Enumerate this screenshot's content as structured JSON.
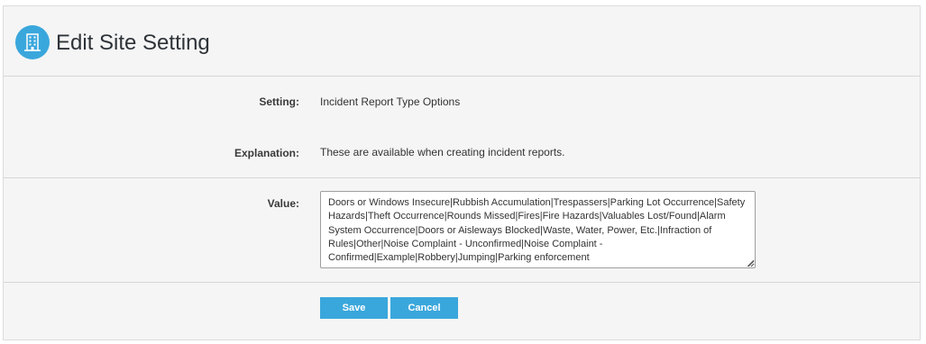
{
  "header": {
    "title": "Edit Site Setting",
    "icon": "building-icon",
    "icon_color": "#3aa7dc"
  },
  "form": {
    "setting_label": "Setting:",
    "setting_value": "Incident Report Type Options",
    "explanation_label": "Explanation:",
    "explanation_value": "These are available when creating incident reports.",
    "value_label": "Value:",
    "value_text": "Doors or Windows Insecure|Rubbish Accumulation|Trespassers|Parking Lot Occurrence|Safety Hazards|Theft Occurrence|Rounds Missed|Fires|Fire Hazards|Valuables Lost/Found|Alarm System Occurrence|Doors or Aisleways Blocked|Waste, Water, Power, Etc.|Infraction of Rules|Other|Noise Complaint - Unconfirmed|Noise Complaint - Confirmed|Example|Robbery|Jumping|Parking enforcement"
  },
  "actions": {
    "save_label": "Save",
    "cancel_label": "Cancel",
    "button_color": "#3aa7dc"
  }
}
